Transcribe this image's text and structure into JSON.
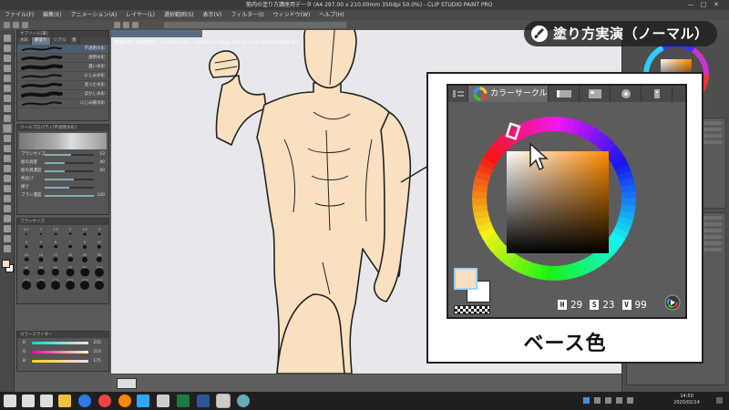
{
  "window": {
    "title": "筋肉の塗り方講座用データ (A4 297.00 x 210.00mm 350dpi 50.0%) - CLIP STUDIO PAINT PRO"
  },
  "menu": [
    "ファイル(F)",
    "編集(E)",
    "アニメーション(A)",
    "レイヤー(L)",
    "選択範囲(S)",
    "表示(V)",
    "フィルター(I)",
    "ウィンドウ(W)",
    "ヘルプ(H)"
  ],
  "subtool": {
    "title": "サブツール[筆]",
    "tabs": [
      "水彩",
      "厚塗り",
      "リアル",
      "墨"
    ],
    "active_tab": 1,
    "brushes": [
      "不透明水彩",
      "透明水彩",
      "濃い水彩",
      "にじみ水彩",
      "湿った水彩",
      "ぼかし水彩",
      "にじみ縁水彩"
    ],
    "selected": 0
  },
  "tool_property": {
    "title": "ツールプロパティ[不透明水彩]",
    "rows": [
      {
        "label": "ブラシサイズ",
        "value": "53",
        "level": 0.53
      },
      {
        "label": "絵の具量",
        "value": "40",
        "level": 0.4
      },
      {
        "label": "絵の具濃度",
        "value": "40",
        "level": 0.4
      },
      {
        "label": "色延び",
        "value": "",
        "level": 0.6
      },
      {
        "label": "硬さ",
        "value": "",
        "level": 0.5
      },
      {
        "label": "ブラシ濃度",
        "value": "100",
        "level": 1.0
      }
    ]
  },
  "brush_size": {
    "title": "ブラシサイズ",
    "sizes": [
      "0.7",
      "1",
      "1.5",
      "2",
      "2.5",
      "3",
      "4",
      "5",
      "6",
      "7",
      "8",
      "10",
      "12",
      "15",
      "17",
      "20",
      "25",
      "30",
      "40",
      "50",
      "60",
      "70",
      "80",
      "100",
      "120",
      "150",
      "170",
      "200",
      "250",
      "300"
    ]
  },
  "color_slider": {
    "title": "カラースライダー",
    "channels": [
      {
        "label": "R",
        "value": "255",
        "gradient": "linear-gradient(90deg,#00dede,#ffdede)"
      },
      {
        "label": "G",
        "value": "214",
        "gradient": "linear-gradient(90deg,#ff00b0,#ffffb0)"
      },
      {
        "label": "B",
        "value": "175",
        "gradient": "linear-gradient(90deg,#ffd600,#ffd6ff)"
      }
    ]
  },
  "badge": {
    "text": "塗り方実演（ノーマル）",
    "icon": "brush-icon"
  },
  "zoom": {
    "tab_label": "カラーサークル",
    "tabs": [
      "color-circle-tab",
      "color-slider-tab",
      "color-set-tab",
      "intermediate-color-tab",
      "approximate-color-tab"
    ],
    "hsv": [
      {
        "key": "H",
        "value": "29"
      },
      {
        "key": "S",
        "value": "23"
      },
      {
        "key": "V",
        "value": "99"
      }
    ],
    "main_color": "#f7dfc0",
    "hue_color": "#ff8a00",
    "caption": "ベース色"
  },
  "taskbar": {
    "time": "14:50",
    "date": "2020/02/14",
    "apps": [
      "windows-start-icon",
      "search-icon",
      "task-view-icon",
      "file-explorer-icon",
      "edge-icon",
      "chrome-icon",
      "firefox-icon",
      "photoshop-icon",
      "store-icon",
      "excel-icon",
      "word-icon",
      "clip-studio-icon",
      "app-icon"
    ]
  }
}
